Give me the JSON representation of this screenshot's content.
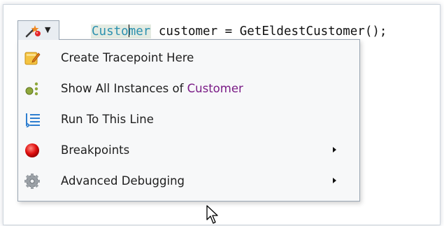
{
  "editor": {
    "code_type": "Custo",
    "code_type_rest": "mer",
    "code_rest": " customer = GetEldestCustomer();"
  },
  "smart_tag": {
    "icon": "wand-icon",
    "dropdown_icon": "chevron-down-icon"
  },
  "menu": {
    "items": [
      {
        "label": "Create Tracepoint Here",
        "icon": "tracepoint-icon"
      },
      {
        "label": "Show All Instances of ",
        "highlight": "Customer",
        "icon": "instances-icon"
      },
      {
        "label": "Run To This Line",
        "icon": "run-to-line-icon"
      },
      {
        "label": "Breakpoints",
        "icon": "breakpoint-icon",
        "submenu": true
      },
      {
        "label": "Advanced Debugging",
        "icon": "gear-icon",
        "submenu": true
      }
    ]
  },
  "colors": {
    "type_name": "#2b91af",
    "highlight": "#7a1b86",
    "breakpoint": "#e01010"
  }
}
